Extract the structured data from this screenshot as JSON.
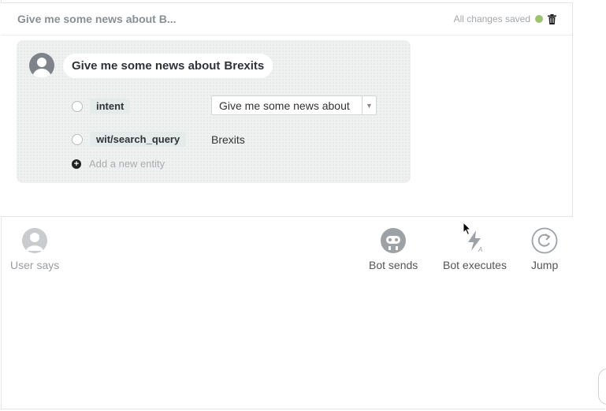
{
  "story": {
    "title": "Give me some news about B...",
    "save_status": "All changes saved"
  },
  "user_turn": {
    "utterance_part1": "Give me some news about",
    "utterance_part2": "Brexits",
    "entities": [
      {
        "name": "intent",
        "value": "Give me some news about"
      },
      {
        "name": "wit/search_query",
        "value": "Brexits"
      }
    ],
    "add_entity_label": "Add a new entity"
  },
  "actions": {
    "user_says": "User says",
    "bot_sends": "Bot sends",
    "bot_executes": "Bot executes",
    "jump": "Jump"
  },
  "colors": {
    "status_dot": "#9cc46e",
    "bubble_bg": "#eef1f0",
    "entity_highlight": "#e4ecea"
  },
  "icons": [
    "trash-icon",
    "user-avatar-icon",
    "plus-icon",
    "robot-icon",
    "lightning-icon",
    "jump-arrow-icon",
    "mouse-cursor"
  ]
}
